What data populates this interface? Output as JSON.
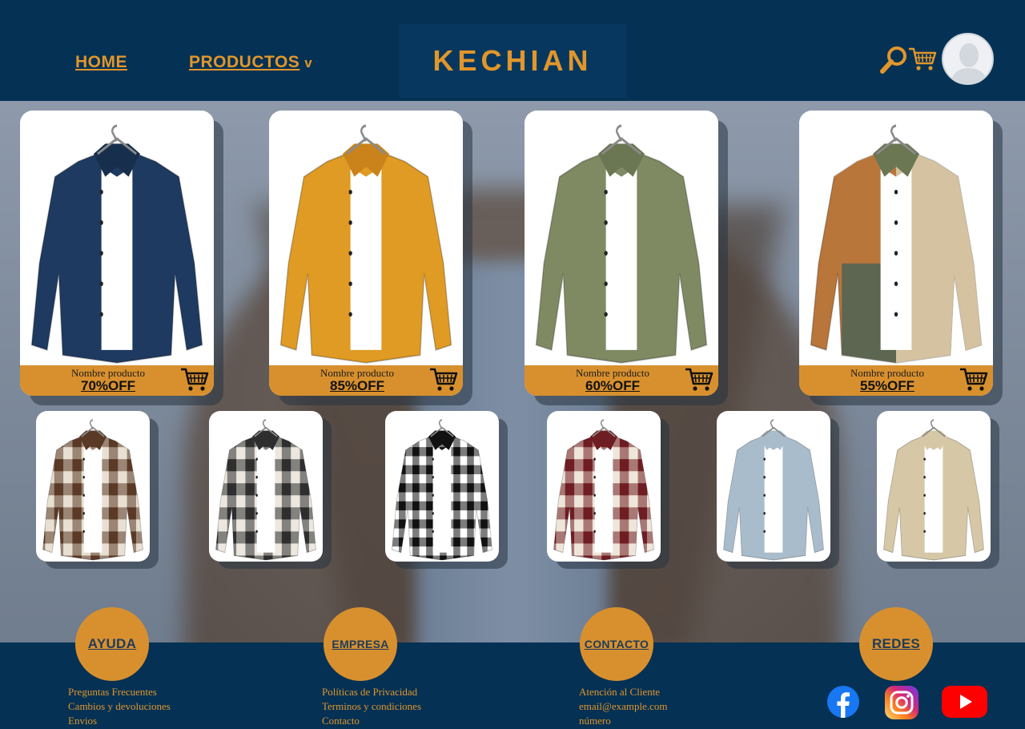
{
  "header": {
    "nav": {
      "home": "HOME",
      "products": "PRODUCTOS",
      "products_chevron": "v"
    },
    "logo": "KECHIAN",
    "icons": [
      "search-icon",
      "cart-icon",
      "avatar"
    ]
  },
  "featured_products": [
    {
      "name": "Nombre producto",
      "discount": "70%OFF",
      "shirt_color": "#1f3a60",
      "accent": "#182e4d",
      "style": "solid"
    },
    {
      "name": "Nombre producto",
      "discount": "85%OFF",
      "shirt_color": "#e09b24",
      "accent": "#c9831a",
      "style": "solid"
    },
    {
      "name": "Nombre producto",
      "discount": "60%OFF",
      "shirt_color": "#7f8a63",
      "accent": "#6b7652",
      "style": "solid"
    },
    {
      "name": "Nombre producto",
      "discount": "55%OFF",
      "shirt_color": "#b9763a",
      "accent": "#5c6651",
      "style": "patchwork"
    }
  ],
  "thumbnails": [
    {
      "pattern": "plaid-brown",
      "color1": "#5a3a26",
      "color2": "#e8e0d2"
    },
    {
      "pattern": "plaid-cream",
      "color1": "#2e2e2e",
      "color2": "#ece8df"
    },
    {
      "pattern": "gingham-black",
      "color1": "#111111",
      "color2": "#ffffff"
    },
    {
      "pattern": "plaid-red",
      "color1": "#6e1d22",
      "color2": "#efe6da"
    },
    {
      "pattern": "solid-light-blue",
      "color1": "#a9bccb",
      "color2": "#a9bccb"
    },
    {
      "pattern": "solid-beige",
      "color1": "#d6c8a6",
      "color2": "#d6c8a6"
    }
  ],
  "footer": {
    "sections": [
      {
        "title": "AYUDA",
        "items": [
          "Preguntas Frecuentes",
          "Cambios y devoluciones",
          "Envios"
        ]
      },
      {
        "title": "EMPRESA",
        "items": [
          "Políticas de Privacidad",
          "Terminos y condiciones",
          "Contacto"
        ]
      },
      {
        "title": "CONTACTO",
        "items": [
          "Atención al Cliente",
          "email@example.com",
          "número"
        ]
      },
      {
        "title": "REDES",
        "items": []
      }
    ],
    "social_icons": [
      "facebook-icon",
      "instagram-icon",
      "youtube-icon"
    ]
  },
  "colors": {
    "navy": "#053154",
    "orange": "#d8902e",
    "text_orange": "#e1962b"
  }
}
